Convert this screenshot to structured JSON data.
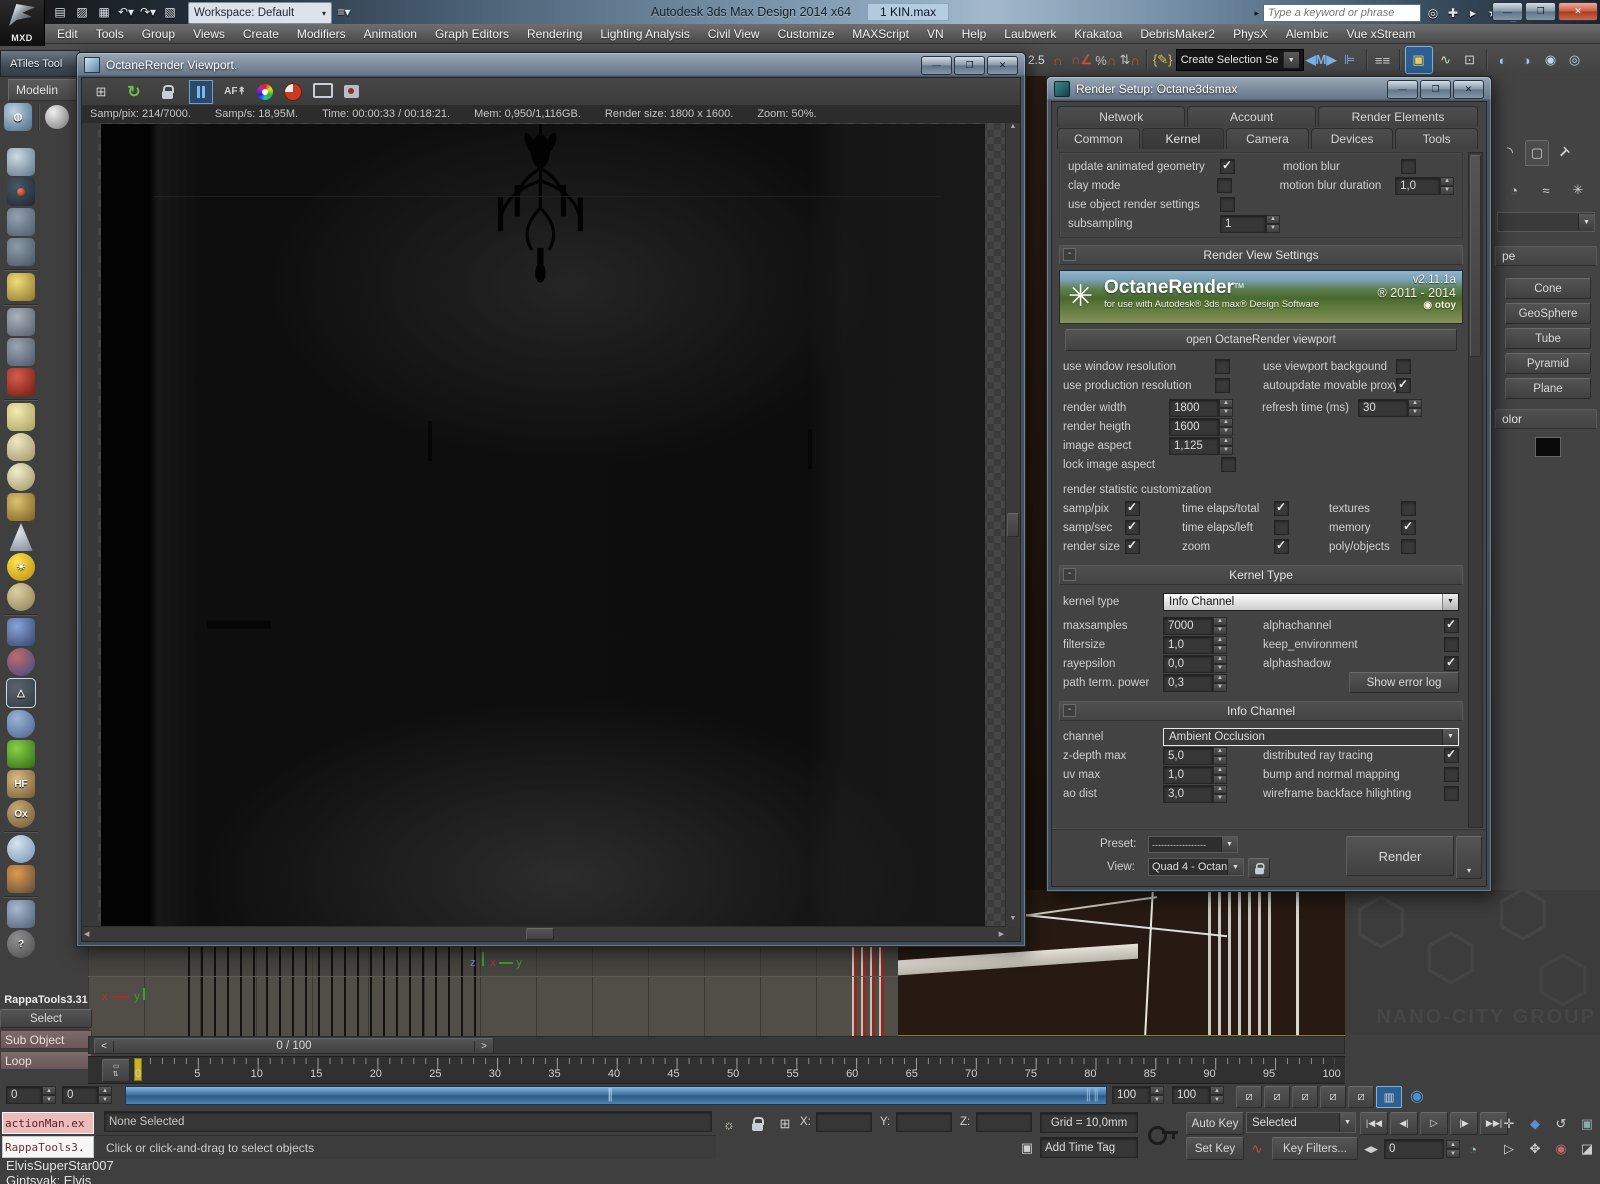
{
  "window": {
    "logo": "MXD",
    "title": "Autodesk 3ds Max Design 2014 x64",
    "document": "1 KIN.max",
    "workspace": "Workspace: Default",
    "search_placeholder": "Type a keyword or phrase"
  },
  "menu": {
    "items": [
      "Edit",
      "Tools",
      "Group",
      "Views",
      "Create",
      "Modifiers",
      "Animation",
      "Graph Editors",
      "Rendering",
      "Lighting Analysis",
      "Civil View",
      "Customize",
      "MAXScript",
      "VN",
      "Help",
      "Laubwerk",
      "Krakatoa",
      "DebrisMaker2",
      "PhysX",
      "Alembic",
      "Vue xStream"
    ]
  },
  "toolbar": {
    "snap_value": "2.5",
    "selection_set_label": "Create Selection Se"
  },
  "left_panel": {
    "atiles_title": "ATiles Tool",
    "ribbon_tab": "Modelin",
    "icon_names": [
      "render-globe-icon",
      "material-sphere-icon",
      "teapot-icon",
      "render-preview-icon",
      "render-settings-icon",
      "render-dialog-icon",
      "light-lister-icon",
      "camera-icon",
      "light-projector-icon",
      "video-camera-icon",
      "plane-icon",
      "dome-icon",
      "sphere-icon",
      "wire-teapot-icon",
      "cone-icon",
      "sun-icon",
      "tan-sphere-icon",
      "scatter-icon",
      "connect-spheres-icon",
      "camera-frustum-icon",
      "rock-icon",
      "grass-icon",
      "hairfarm-icon",
      "ornatrix-icon",
      "blue-sphere-icon",
      "material-grid-icon",
      "script-doc-icon",
      "help-icon"
    ],
    "hf_label": "HF",
    "ox_label": "Ox",
    "help_label": "?"
  },
  "rappatools": {
    "title": "RappaTools3.31",
    "select": "Select",
    "sub_object": "Sub Object",
    "loop": "Loop"
  },
  "octane_viewport": {
    "title": "OctaneRender Viewport.",
    "af_label": "AF",
    "stats": [
      "Samp/pix: 214/7000.",
      "Samp/s: 18,95M.",
      "Time: 00:00:33 / 00:18:21.",
      "Mem: 0,950/1,116GB.",
      "Render size: 1800 x 1600.",
      "Zoom: 50%."
    ]
  },
  "render_setup": {
    "title": "Render Setup: Octane3dsmax",
    "tabs_top": [
      "Network",
      "Account",
      "Render Elements"
    ],
    "tabs_bottom": [
      "Common",
      "Kernel",
      "Camera",
      "Devices",
      "Tools"
    ],
    "geometry": {
      "update_animated": {
        "label": "update animated geometry",
        "checked": true
      },
      "clay_mode": {
        "label": "clay mode",
        "checked": false
      },
      "use_object": {
        "label": "use object render settings",
        "checked": false
      },
      "subsampling": {
        "label": "subsampling",
        "value": "1"
      },
      "motion_blur": {
        "label": "motion blur",
        "checked": false
      },
      "motion_blur_duration": {
        "label": "motion blur duration",
        "value": "1,0"
      }
    },
    "view_settings": {
      "header": "Render View Settings",
      "banner": {
        "brand": "OctaneRender",
        "tm": "TM",
        "tagline": "for use with Autodesk® 3ds max® Design Software",
        "version": "v2.11.1a",
        "years": "® 2011 - 2014",
        "otoy": "otoy"
      },
      "open_button": "open OctaneRender viewport",
      "use_window": {
        "label": "use window resolution",
        "checked": false
      },
      "use_production": {
        "label": "use production resolution",
        "checked": false
      },
      "use_viewport_bg": {
        "label": "use viewport backgound",
        "checked": false
      },
      "autoupdate_proxy": {
        "label": "autoupdate movable proxy",
        "checked": true
      },
      "render_width": {
        "label": "render width",
        "value": "1800"
      },
      "render_height": {
        "label": "render heigth",
        "value": "1600"
      },
      "image_aspect": {
        "label": "image aspect",
        "value": "1,125"
      },
      "lock_aspect": {
        "label": "lock image aspect",
        "checked": false
      },
      "refresh_time": {
        "label": "refresh time (ms)",
        "value": "30"
      },
      "stat_header": "render statistic customization",
      "stats": [
        [
          {
            "label": "samp/pix",
            "checked": true
          },
          {
            "label": "time elaps/total",
            "checked": true
          },
          {
            "label": "textures",
            "checked": false
          }
        ],
        [
          {
            "label": "samp/sec",
            "checked": true
          },
          {
            "label": "time elaps/left",
            "checked": false
          },
          {
            "label": "memory",
            "checked": true
          }
        ],
        [
          {
            "label": "render size",
            "checked": true
          },
          {
            "label": "zoom",
            "checked": true
          },
          {
            "label": "poly/objects",
            "checked": false
          }
        ]
      ]
    },
    "kernel": {
      "header": "Kernel Type",
      "type_label": "kernel type",
      "type_value": "Info Channel",
      "maxsamples": {
        "label": "maxsamples",
        "value": "7000"
      },
      "filtersize": {
        "label": "filtersize",
        "value": "1,0"
      },
      "rayepsilon": {
        "label": "rayepsilon",
        "value": "0,0"
      },
      "path_term": {
        "label": "path term. power",
        "value": "0,3"
      },
      "alphachannel": {
        "label": "alphachannel",
        "checked": true
      },
      "keep_environment": {
        "label": "keep_environment",
        "checked": false
      },
      "alphashadow": {
        "label": "alphashadow",
        "checked": true
      },
      "error_log_button": "Show error log"
    },
    "info_channel": {
      "header": "Info Channel",
      "channel_label": "channel",
      "channel_value": "Ambient Occlusion",
      "zdepth": {
        "label": "z-depth max",
        "value": "5,0"
      },
      "uvmax": {
        "label": "uv max",
        "value": "1,0"
      },
      "aodist": {
        "label": "ao dist",
        "value": "3,0"
      },
      "distributed": {
        "label": "distributed ray tracing",
        "checked": true
      },
      "bump_normal": {
        "label": "bump and normal mapping",
        "checked": false
      },
      "wireframe_backface": {
        "label": "wireframe backface hilighting",
        "checked": false
      }
    },
    "footer": {
      "preset_label": "Preset:",
      "preset_value": "------------------",
      "view_label": "View:",
      "view_value": "Quad 4 - Octan",
      "render_button": "Render"
    }
  },
  "command_panel": {
    "object_type_header": "pe",
    "buttons": [
      "Cone",
      "GeoSphere",
      "Tube",
      "Pyramid",
      "Plane"
    ],
    "color_header": "olor"
  },
  "timeline": {
    "slider_label": "0 / 100",
    "prev": "<",
    "next": ">",
    "ticks": [
      "0",
      "5",
      "10",
      "15",
      "20",
      "25",
      "30",
      "35",
      "40",
      "45",
      "50",
      "55",
      "60",
      "65",
      "70",
      "75",
      "80",
      "85",
      "90",
      "95",
      "100"
    ],
    "left_spinners": [
      "0",
      "0"
    ],
    "right_spinners": [
      "100",
      "100"
    ]
  },
  "status": {
    "script1": "actionMan.ex",
    "script2": "RappaTools3.",
    "selection": "None Selected",
    "prompt": "Click or click-and-drag to select objects",
    "x_label": "X:",
    "y_label": "Y:",
    "z_label": "Z:",
    "grid": "Grid = 10,0mm",
    "add_time_tag": "Add Time Tag",
    "auto_key": "Auto Key",
    "set_key": "Set Key",
    "selected_value": "Selected",
    "key_filters": "Key Filters...",
    "frame_value": "0",
    "user_line1": "ElvisSuperStar007",
    "user_line2": "Gintsyak: Elvis"
  },
  "watermark": {
    "text": "NANO-CITY GROUP"
  }
}
